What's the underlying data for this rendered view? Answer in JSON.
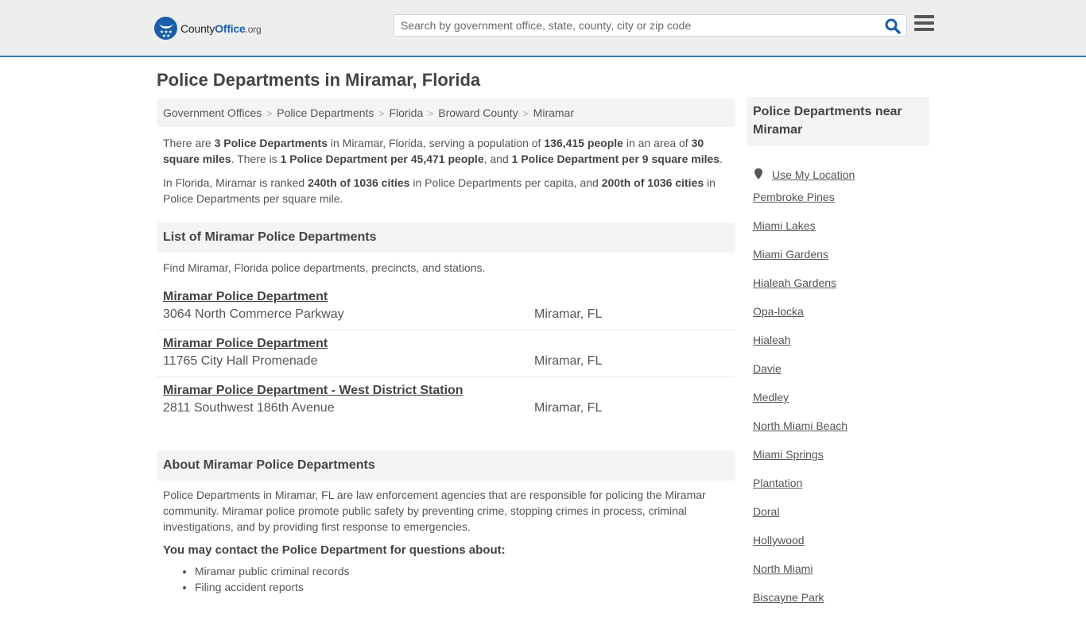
{
  "header": {
    "logo": {
      "name_part1": "County",
      "name_part2": "Office",
      "tld": ".org"
    },
    "search": {
      "placeholder": "Search by government office, state, county, city or zip code",
      "value": ""
    },
    "search_icon": "search-icon",
    "menu_icon": "hamburger-menu-icon"
  },
  "page": {
    "title": "Police Departments in Miramar, Florida"
  },
  "breadcrumb": [
    "Government Offices",
    "Police Departments",
    "Florida",
    "Broward County",
    "Miramar"
  ],
  "summary": {
    "p1": {
      "t1": "There are ",
      "b1": "3 Police Departments",
      "t2": " in Miramar, Florida, serving a population of ",
      "b2": "136,415 people",
      "t3": " in an area of ",
      "b3": "30 square miles",
      "t4": ". There is ",
      "b4": "1 Police Department per 45,471 people",
      "t5": ", and ",
      "b5": "1 Police Department per 9 square miles",
      "t6": "."
    },
    "p2": {
      "t1": "In Florida, Miramar is ranked ",
      "b1": "240th of 1036 cities",
      "t2": " in Police Departments per capita, and ",
      "b2": "200th of 1036 cities",
      "t3": " in Police Departments per square mile."
    }
  },
  "list_section": {
    "heading": "List of Miramar Police Departments",
    "intro": "Find Miramar, Florida police departments, precincts, and stations.",
    "entries": [
      {
        "name": "Miramar Police Department",
        "address": "3064 North Commerce Parkway",
        "city": "Miramar, FL"
      },
      {
        "name": "Miramar Police Department",
        "address": "11765 City Hall Promenade",
        "city": "Miramar, FL"
      },
      {
        "name": "Miramar Police Department - West District Station",
        "address": "2811 Southwest 186th Avenue",
        "city": "Miramar, FL"
      }
    ]
  },
  "about_section": {
    "heading": "About Miramar Police Departments",
    "body": "Police Departments in Miramar, FL are law enforcement agencies that are responsible for policing the Miramar community. Miramar police promote public safety by preventing crime, stopping crimes in process, criminal investigations, and by providing first response to emergencies.",
    "contact_heading": "You may contact the Police Department for questions about:",
    "contact_items": [
      "Miramar public criminal records",
      "Filing accident reports"
    ]
  },
  "sidebar": {
    "heading": "Police Departments near Miramar",
    "use_location": "Use My Location",
    "location_icon": "map-marker-icon",
    "nearby": [
      "Pembroke Pines",
      "Miami Lakes",
      "Miami Gardens",
      "Hialeah Gardens",
      "Opa-locka",
      "Hialeah",
      "Davie",
      "Medley",
      "North Miami Beach",
      "Miami Springs",
      "Plantation",
      "Doral",
      "Hollywood",
      "North Miami",
      "Biscayne Park"
    ]
  },
  "colors": {
    "brand_blue": "#1a5ea8",
    "header_border": "#3a7bb0",
    "header_bg": "#eeeeee",
    "panel_bg": "#f4f4f4"
  }
}
